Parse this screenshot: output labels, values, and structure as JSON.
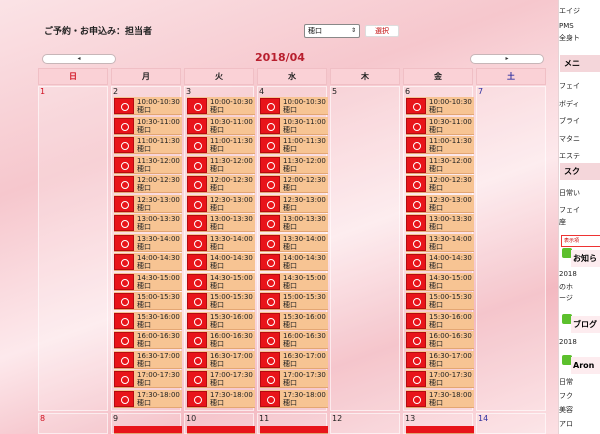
{
  "header": {
    "title": "ご予約・お申込み：担当者",
    "staff_selected": "穂口",
    "select_button": "選択",
    "month": "2018/04",
    "prev_label": "◂",
    "next_label": "▸"
  },
  "weekdays": [
    "日",
    "月",
    "火",
    "水",
    "木",
    "金",
    "土"
  ],
  "week1": {
    "days": [
      "1",
      "2",
      "3",
      "4",
      "5",
      "6",
      "7"
    ]
  },
  "week2": {
    "days": [
      "8",
      "9",
      "10",
      "11",
      "12",
      "13",
      "14"
    ]
  },
  "slots": [
    {
      "time": "10:00-10:30",
      "staff": "穂口"
    },
    {
      "time": "10:30-11:00",
      "staff": "穂口"
    },
    {
      "time": "11:00-11:30",
      "staff": "穂口"
    },
    {
      "time": "11:30-12:00",
      "staff": "穂口"
    },
    {
      "time": "12:00-12:30",
      "staff": "穂口"
    },
    {
      "time": "12:30-13:00",
      "staff": "穂口"
    },
    {
      "time": "13:00-13:30",
      "staff": "穂口"
    },
    {
      "time": "13:30-14:00",
      "staff": "穂口"
    },
    {
      "time": "14:00-14:30",
      "staff": "穂口"
    },
    {
      "time": "14:30-15:00",
      "staff": "穂口"
    },
    {
      "time": "15:00-15:30",
      "staff": "穂口"
    },
    {
      "time": "15:30-16:00",
      "staff": "穂口"
    },
    {
      "time": "16:00-16:30",
      "staff": "穂口"
    },
    {
      "time": "16:30-17:00",
      "staff": "穂口"
    },
    {
      "time": "17:00-17:30",
      "staff": "穂口"
    },
    {
      "time": "17:30-18:00",
      "staff": "穂口"
    }
  ],
  "sidebar": {
    "top_link": "エイジ",
    "pms_line1": "PMS",
    "pms_line2": "全身ト",
    "menu_head": "メニ",
    "menu_items": [
      "フェイ",
      "ボディ",
      "ブライ",
      "マタニ",
      "エステ"
    ],
    "school_head": "スク",
    "school_items": [
      "日常い",
      "フェイ"
    ],
    "school_item2_cont": "座",
    "flag_label": "表示項",
    "news_head": "お知ら",
    "news_line1": "2018",
    "news_line2": "のホ",
    "news_line3": "ージ",
    "blog_head": "ブログ",
    "blog_line1": "2018",
    "aroma_head": "Aron",
    "aroma_items": [
      "日常",
      "フク",
      "美容",
      "アロ"
    ]
  }
}
